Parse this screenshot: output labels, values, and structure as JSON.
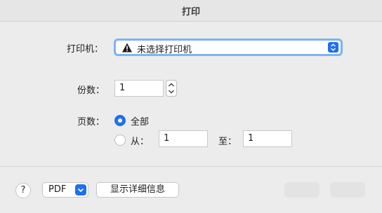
{
  "window": {
    "title": "打印"
  },
  "printer": {
    "label": "打印机：",
    "selected": "未选择打印机",
    "warning_icon": "warning-triangle-icon",
    "accent": "#1f6ff0"
  },
  "copies": {
    "label": "份数：",
    "value": "1"
  },
  "pages": {
    "label": "页数：",
    "all_label": "全部",
    "range_from_label": "从：",
    "range_to_label": "至：",
    "from_value": "1",
    "to_value": "1",
    "selected": "all"
  },
  "footer": {
    "help_label": "?",
    "pdf_label": "PDF",
    "details_label": "显示详细信息"
  }
}
